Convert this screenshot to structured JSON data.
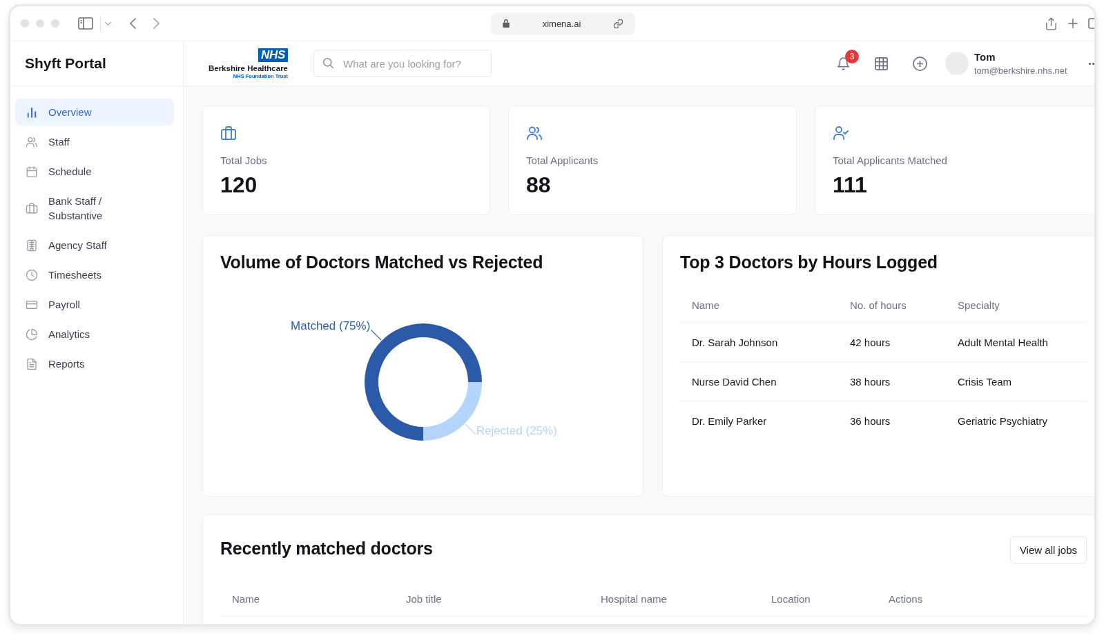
{
  "browser": {
    "url": "ximena.ai"
  },
  "sidebar": {
    "title": "Shyft Portal",
    "items": [
      {
        "label": "Overview",
        "selected": true
      },
      {
        "label": "Staff",
        "selected": false
      },
      {
        "label": "Schedule",
        "selected": false
      },
      {
        "label": "Bank Staff / Substantive",
        "selected": false
      },
      {
        "label": "Agency Staff",
        "selected": false
      },
      {
        "label": "Timesheets",
        "selected": false
      },
      {
        "label": "Payroll",
        "selected": false
      },
      {
        "label": "Analytics",
        "selected": false
      },
      {
        "label": "Reports",
        "selected": false
      }
    ]
  },
  "header": {
    "logo": {
      "badge": "NHS",
      "name": "Berkshire Healthcare",
      "subtitle": "NHS Foundation Trust"
    },
    "search": {
      "placeholder": "What are you looking for?"
    },
    "notifications": {
      "count": "3"
    },
    "user": {
      "name": "Tom",
      "email": "tom@berkshire.nhs.net"
    }
  },
  "stats": [
    {
      "label": "Total Jobs",
      "value": "120"
    },
    {
      "label": "Total Applicants",
      "value": "88"
    },
    {
      "label": "Total Applicants Matched",
      "value": "111"
    }
  ],
  "volume_chart": {
    "chart_data": {
      "type": "donut",
      "title": "Volume of Doctors Matched vs Rejected",
      "values": [
        75,
        25
      ],
      "colors": [
        "#2b5ba8",
        "#b3d4fb"
      ],
      "value_labels": [
        "Matched (75%)",
        "Rejected (25%)"
      ]
    }
  },
  "top_doctors": {
    "title": "Top 3 Doctors by Hours Logged",
    "columns": [
      "Name",
      "No. of hours",
      "Specialty"
    ],
    "rows": [
      [
        "Dr. Sarah Johnson",
        "42 hours",
        "Adult Mental Health"
      ],
      [
        "Nurse David Chen",
        "38 hours",
        "Crisis Team"
      ],
      [
        "Dr. Emily Parker",
        "36 hours",
        "Geriatric Psychiatry"
      ]
    ]
  },
  "recent_matches": {
    "title": "Recently matched doctors",
    "button": "View all jobs",
    "columns": [
      "Name",
      "Job title",
      "Hospital name",
      "Location",
      "Actions"
    ]
  }
}
